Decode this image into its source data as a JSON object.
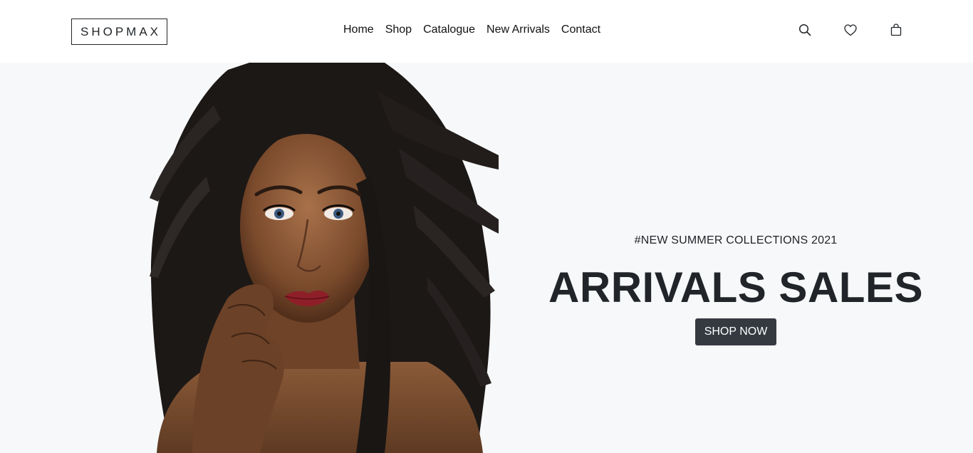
{
  "brand": {
    "logo_text": "SHOPMAX"
  },
  "nav": {
    "items": [
      {
        "label": "Home"
      },
      {
        "label": "Shop"
      },
      {
        "label": "Catalogue"
      },
      {
        "label": "New Arrivals"
      },
      {
        "label": "Contact"
      }
    ],
    "icons": [
      "search-icon",
      "heart-icon",
      "shopping-bag-icon"
    ]
  },
  "hero": {
    "tagline": "#NEW SUMMER COLLECTIONS 2021",
    "headline": "ARRIVALS SALES",
    "cta_label": "SHOP NOW",
    "image_subject": "woman-portrait"
  },
  "colors": {
    "hero_background": "#f7f8fa",
    "button_background": "#343a40",
    "text": "#212529"
  }
}
